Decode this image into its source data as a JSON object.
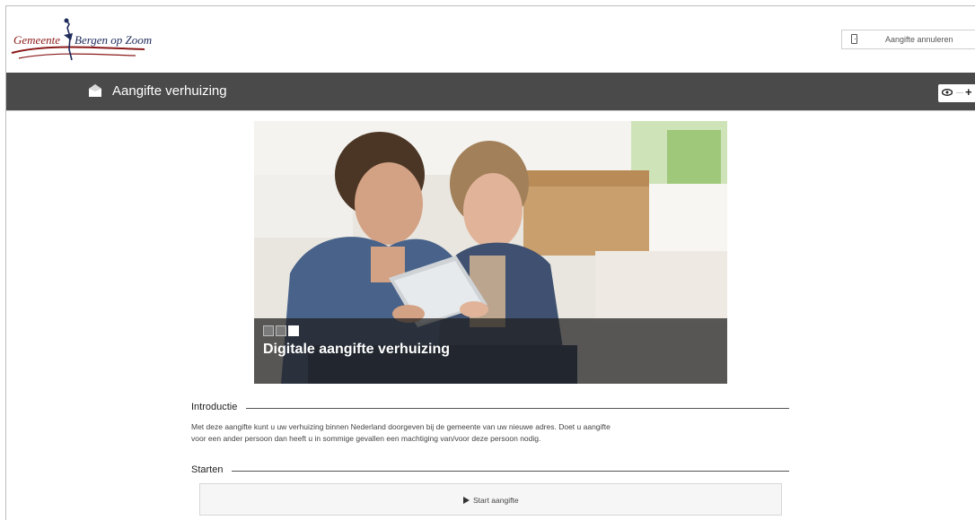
{
  "header": {
    "logo_text_part1": "Gemeente",
    "logo_text_part2": "Bergen op Zoom",
    "cancel_label": "Aangifte annuleren",
    "cancel_icon": "door-icon"
  },
  "titlebar": {
    "title": "Aangifte verhuizing",
    "icon": "home-icon",
    "accessibility": {
      "eye_icon": "eye-icon",
      "plus_label": "+"
    }
  },
  "hero": {
    "caption": "Digitale aangifte verhuizing",
    "slides": 3,
    "active_slide": 3
  },
  "introduction": {
    "heading": "Introductie",
    "line1": "Met deze aangifte kunt u uw verhuizing binnen Nederland doorgeven bij de gemeente van uw nieuwe adres. Doet u aangifte",
    "line2": "voor een ander persoon dan heeft u in sommige gevallen een machtiging van/voor deze persoon nodig."
  },
  "start": {
    "heading": "Starten",
    "button_label": "Start aangifte",
    "button_icon": "play-icon"
  },
  "colors": {
    "titlebar_bg": "#4a4a4a",
    "logo_red": "#8b1a1a",
    "logo_navy": "#1e2a5a"
  }
}
